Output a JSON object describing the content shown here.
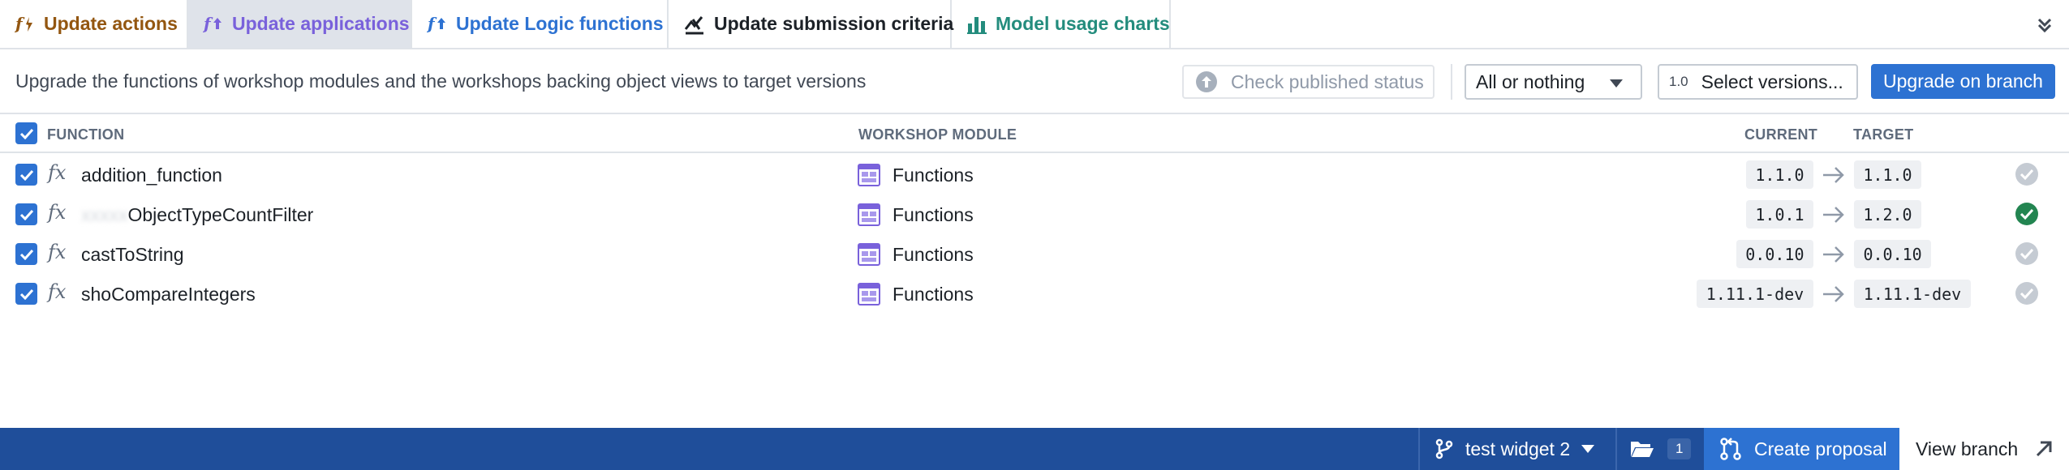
{
  "tabs": [
    {
      "label": "Update actions",
      "icon": "function-bolt-icon",
      "color": "#935610"
    },
    {
      "label": "Update applications",
      "icon": "function-upload-icon",
      "color": "#7961db",
      "active": true
    },
    {
      "label": "Update Logic functions",
      "icon": "function-upload-icon",
      "color": "#2d72d2"
    },
    {
      "label": "Update submission criteria",
      "icon": "criteria-icon",
      "color": "#1c2127"
    },
    {
      "label": "Model usage charts",
      "icon": "bar-chart-icon",
      "color": "#238c7d"
    }
  ],
  "toolbar": {
    "description": "Upgrade the functions of workshop modules and the workshops backing object views to target versions",
    "check_status_label": "Check published status",
    "mode_select_value": "All or nothing",
    "versions_tag": "1.0",
    "versions_label": "Select versions...",
    "upgrade_label": "Upgrade on branch"
  },
  "table": {
    "headers": {
      "function": "FUNCTION",
      "module": "WORKSHOP MODULE",
      "current": "CURRENT",
      "target": "TARGET"
    },
    "rows": [
      {
        "prefix": "",
        "name": "addition_function",
        "module": "Functions",
        "current": "1.1.0",
        "target": "1.1.0",
        "status": "unchanged",
        "checked": true
      },
      {
        "prefix": "xxxxx",
        "name": "ObjectTypeCountFilter",
        "module": "Functions",
        "current": "1.0.1",
        "target": "1.2.0",
        "status": "upgrade",
        "checked": true
      },
      {
        "prefix": "",
        "name": "castToString",
        "module": "Functions",
        "current": "0.0.10",
        "target": "0.0.10",
        "status": "unchanged",
        "checked": true
      },
      {
        "prefix": "",
        "name": "shoCompareIntegers",
        "module": "Functions",
        "current": "1.11.1-dev",
        "target": "1.11.1-dev",
        "status": "unchanged",
        "checked": true
      }
    ]
  },
  "footer": {
    "branch_name": "test widget 2",
    "changes_count": "1",
    "create_proposal_label": "Create proposal",
    "view_branch_label": "View branch"
  },
  "colors": {
    "accent": "#2d72d2",
    "footer": "#1f4e9a",
    "success": "#238551"
  }
}
